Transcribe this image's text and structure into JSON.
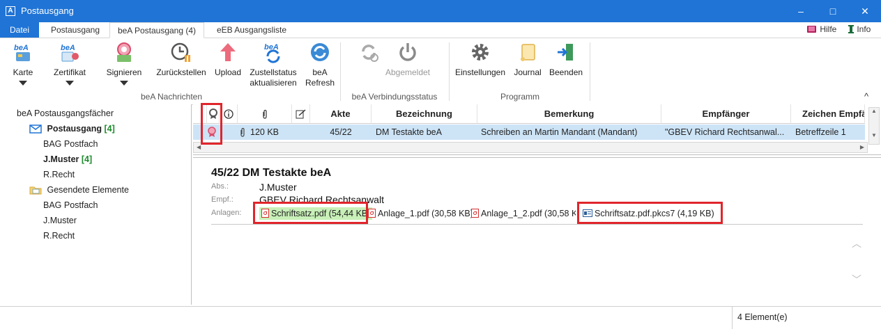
{
  "window": {
    "title": "Postausgang",
    "minimize": "–",
    "maximize": "□",
    "close": "✕"
  },
  "tabs": [
    {
      "label": "Datei"
    },
    {
      "label": "Postausgang"
    },
    {
      "label": "beA Postausgang (4)"
    },
    {
      "label": "eEB Ausgangsliste"
    }
  ],
  "top_tools": {
    "help": "Hilfe",
    "info": "Info"
  },
  "ribbon": {
    "buttons": {
      "karte": "Karte",
      "zertifikat": "Zertifikat",
      "signieren": "Signieren",
      "zurueckstellen": "Zurückstellen",
      "upload": "Upload",
      "zustellstatus_1": "Zustellstatus",
      "zustellstatus_2": "aktualisieren",
      "refresh_1": "beA",
      "refresh_2": "Refresh",
      "abgemeldet": "Abgemeldet",
      "einstellungen": "Einstellungen",
      "journal": "Journal",
      "beenden": "Beenden"
    },
    "groups": {
      "nachrichten": "beA Nachrichten",
      "verbindung": "beA Verbindungsstatus",
      "programm": "Programm"
    },
    "collapse": "^"
  },
  "tree": {
    "root": "beA Postausgangsfächer",
    "postausgang": {
      "label": "Postausgang",
      "count": "[4]"
    },
    "out_items": [
      {
        "label": "BAG Postfach"
      },
      {
        "label": "J.Muster",
        "count": "[4]"
      },
      {
        "label": "R.Recht"
      }
    ],
    "gesendete": {
      "label": "Gesendete Elemente"
    },
    "sent_items": [
      {
        "label": "BAG Postfach"
      },
      {
        "label": "J.Muster"
      },
      {
        "label": "R.Recht"
      }
    ]
  },
  "grid": {
    "columns": {
      "akte": "Akte",
      "bezeichnung": "Bezeichnung",
      "bemerkung": "Bemerkung",
      "empfaenger": "Empfänger",
      "zeichen": "Zeichen Empfä"
    },
    "row": {
      "size": "120 KB",
      "akte": "45/22",
      "bezeichnung": "DM Testakte beA",
      "bemerkung": "Schreiben an Martin Mandant (Mandant)",
      "empfaenger": "\"GBEV  Richard  Rechtsanwal...",
      "zeichen": "Betreffzeile 1"
    }
  },
  "preview": {
    "title": "45/22 DM Testakte beA",
    "abs_label": "Abs.:",
    "abs_value": "J.Muster",
    "empf_label": "Empf.:",
    "empf_value": "GBEV Richard Rechtsanwalt",
    "anlagen_label": "Anlagen:",
    "attachments": [
      {
        "name": "Schriftsatz.pdf (54,44 KB)"
      },
      {
        "name": "Anlage_1.pdf (30,58 KB)"
      },
      {
        "name": "Anlage_1_2.pdf (30,58 KB)"
      },
      {
        "name": "Schriftsatz.pdf.pkcs7 (4,19 KB)"
      }
    ]
  },
  "status": {
    "count": "4 Element(e)"
  },
  "colors": {
    "accent": "#1f74d6",
    "highlight": "#e0252b",
    "selection": "#cde4f7",
    "count": "#1d8a2c"
  }
}
